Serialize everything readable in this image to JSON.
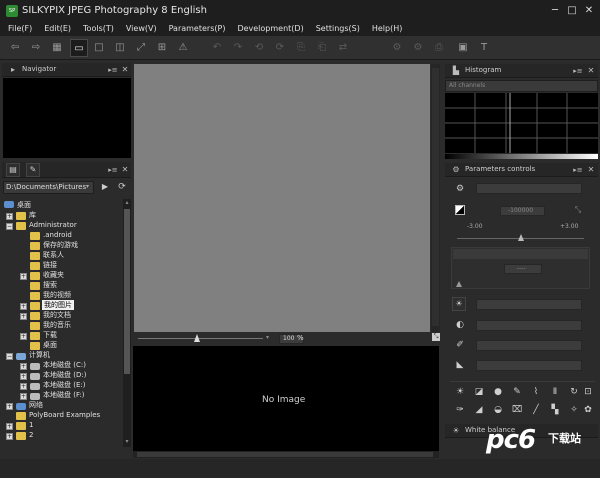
{
  "window": {
    "title": "SILKYPIX JPEG Photography 8 English",
    "logo": "SP"
  },
  "menu": [
    "File(F)",
    "Edit(E)",
    "Tools(T)",
    "View(V)",
    "Parameters(P)",
    "Development(D)",
    "Settings(S)",
    "Help(H)"
  ],
  "navigator": {
    "title": "Navigator"
  },
  "browser": {
    "path": "D:\\Documents\\Pictures",
    "tree": [
      {
        "label": "桌面"
      },
      {
        "label": "库"
      },
      {
        "label": "Administrator"
      },
      {
        "label": ".android"
      },
      {
        "label": "保存的游戏"
      },
      {
        "label": "联系人"
      },
      {
        "label": "链接"
      },
      {
        "label": "收藏夹"
      },
      {
        "label": "搜索"
      },
      {
        "label": "我的视频"
      },
      {
        "label": "我的图片"
      },
      {
        "label": "我的文档"
      },
      {
        "label": "我的音乐"
      },
      {
        "label": "下载"
      },
      {
        "label": "桌面"
      },
      {
        "label": "计算机"
      },
      {
        "label": "本地磁盘 (C:)"
      },
      {
        "label": "本地磁盘 (D:)"
      },
      {
        "label": "本地磁盘 (E:)"
      },
      {
        "label": "本地磁盘 (F:)"
      },
      {
        "label": "网络"
      },
      {
        "label": "PolyBoard Examples"
      },
      {
        "label": "1"
      },
      {
        "label": "2"
      }
    ]
  },
  "viewer": {
    "zoom": "100",
    "zoom_unit": "%",
    "no_image": "No Image"
  },
  "histogram": {
    "title": "Histogram",
    "channel": "All channels"
  },
  "params": {
    "title": "Parameters controls",
    "exposure_value": "-100000",
    "range_min": "-3.00",
    "range_max": "+3.00",
    "dash_value": "----"
  },
  "white_balance": {
    "title": "White balance"
  },
  "watermark": {
    "brand": "pc6",
    "site": "下载站"
  },
  "colors": {
    "bg": "#2b2b2b",
    "canvas": "#808080",
    "folder": "#e2c14a",
    "selected": "#f0f0f0"
  }
}
